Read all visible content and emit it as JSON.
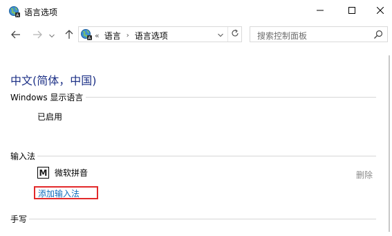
{
  "window": {
    "title": "语言选项",
    "icon": "globe-control-panel-icon",
    "minimize_icon": "minimize-icon",
    "maximize_icon": "maximize-icon",
    "close_icon": "close-icon"
  },
  "navigation": {
    "back_icon": "arrow-left-icon",
    "forward_icon": "arrow-right-icon",
    "recent_icon": "chevron-down-icon",
    "up_icon": "arrow-up-icon",
    "address": {
      "leading": "«",
      "crumbs": [
        "语言",
        "语言选项"
      ],
      "separator": "›"
    },
    "refresh_icon": "refresh-icon",
    "search": {
      "placeholder": "搜索控制面板"
    }
  },
  "main": {
    "language_title": "中文(简体，中国)",
    "display_language": {
      "heading": "Windows 显示语言",
      "status": "已启用"
    },
    "input_method": {
      "heading": "输入法",
      "items": [
        {
          "icon_letter": "M",
          "name": "微软拼音",
          "remove_label": "删除"
        }
      ],
      "add_label": "添加输入法"
    },
    "handwriting": {
      "heading": "手写"
    }
  },
  "colors": {
    "title_blue": "#1e3287",
    "link_blue": "#0f6cbd",
    "highlight_red": "#e2292a",
    "disabled_gray": "#8a8a8a"
  }
}
